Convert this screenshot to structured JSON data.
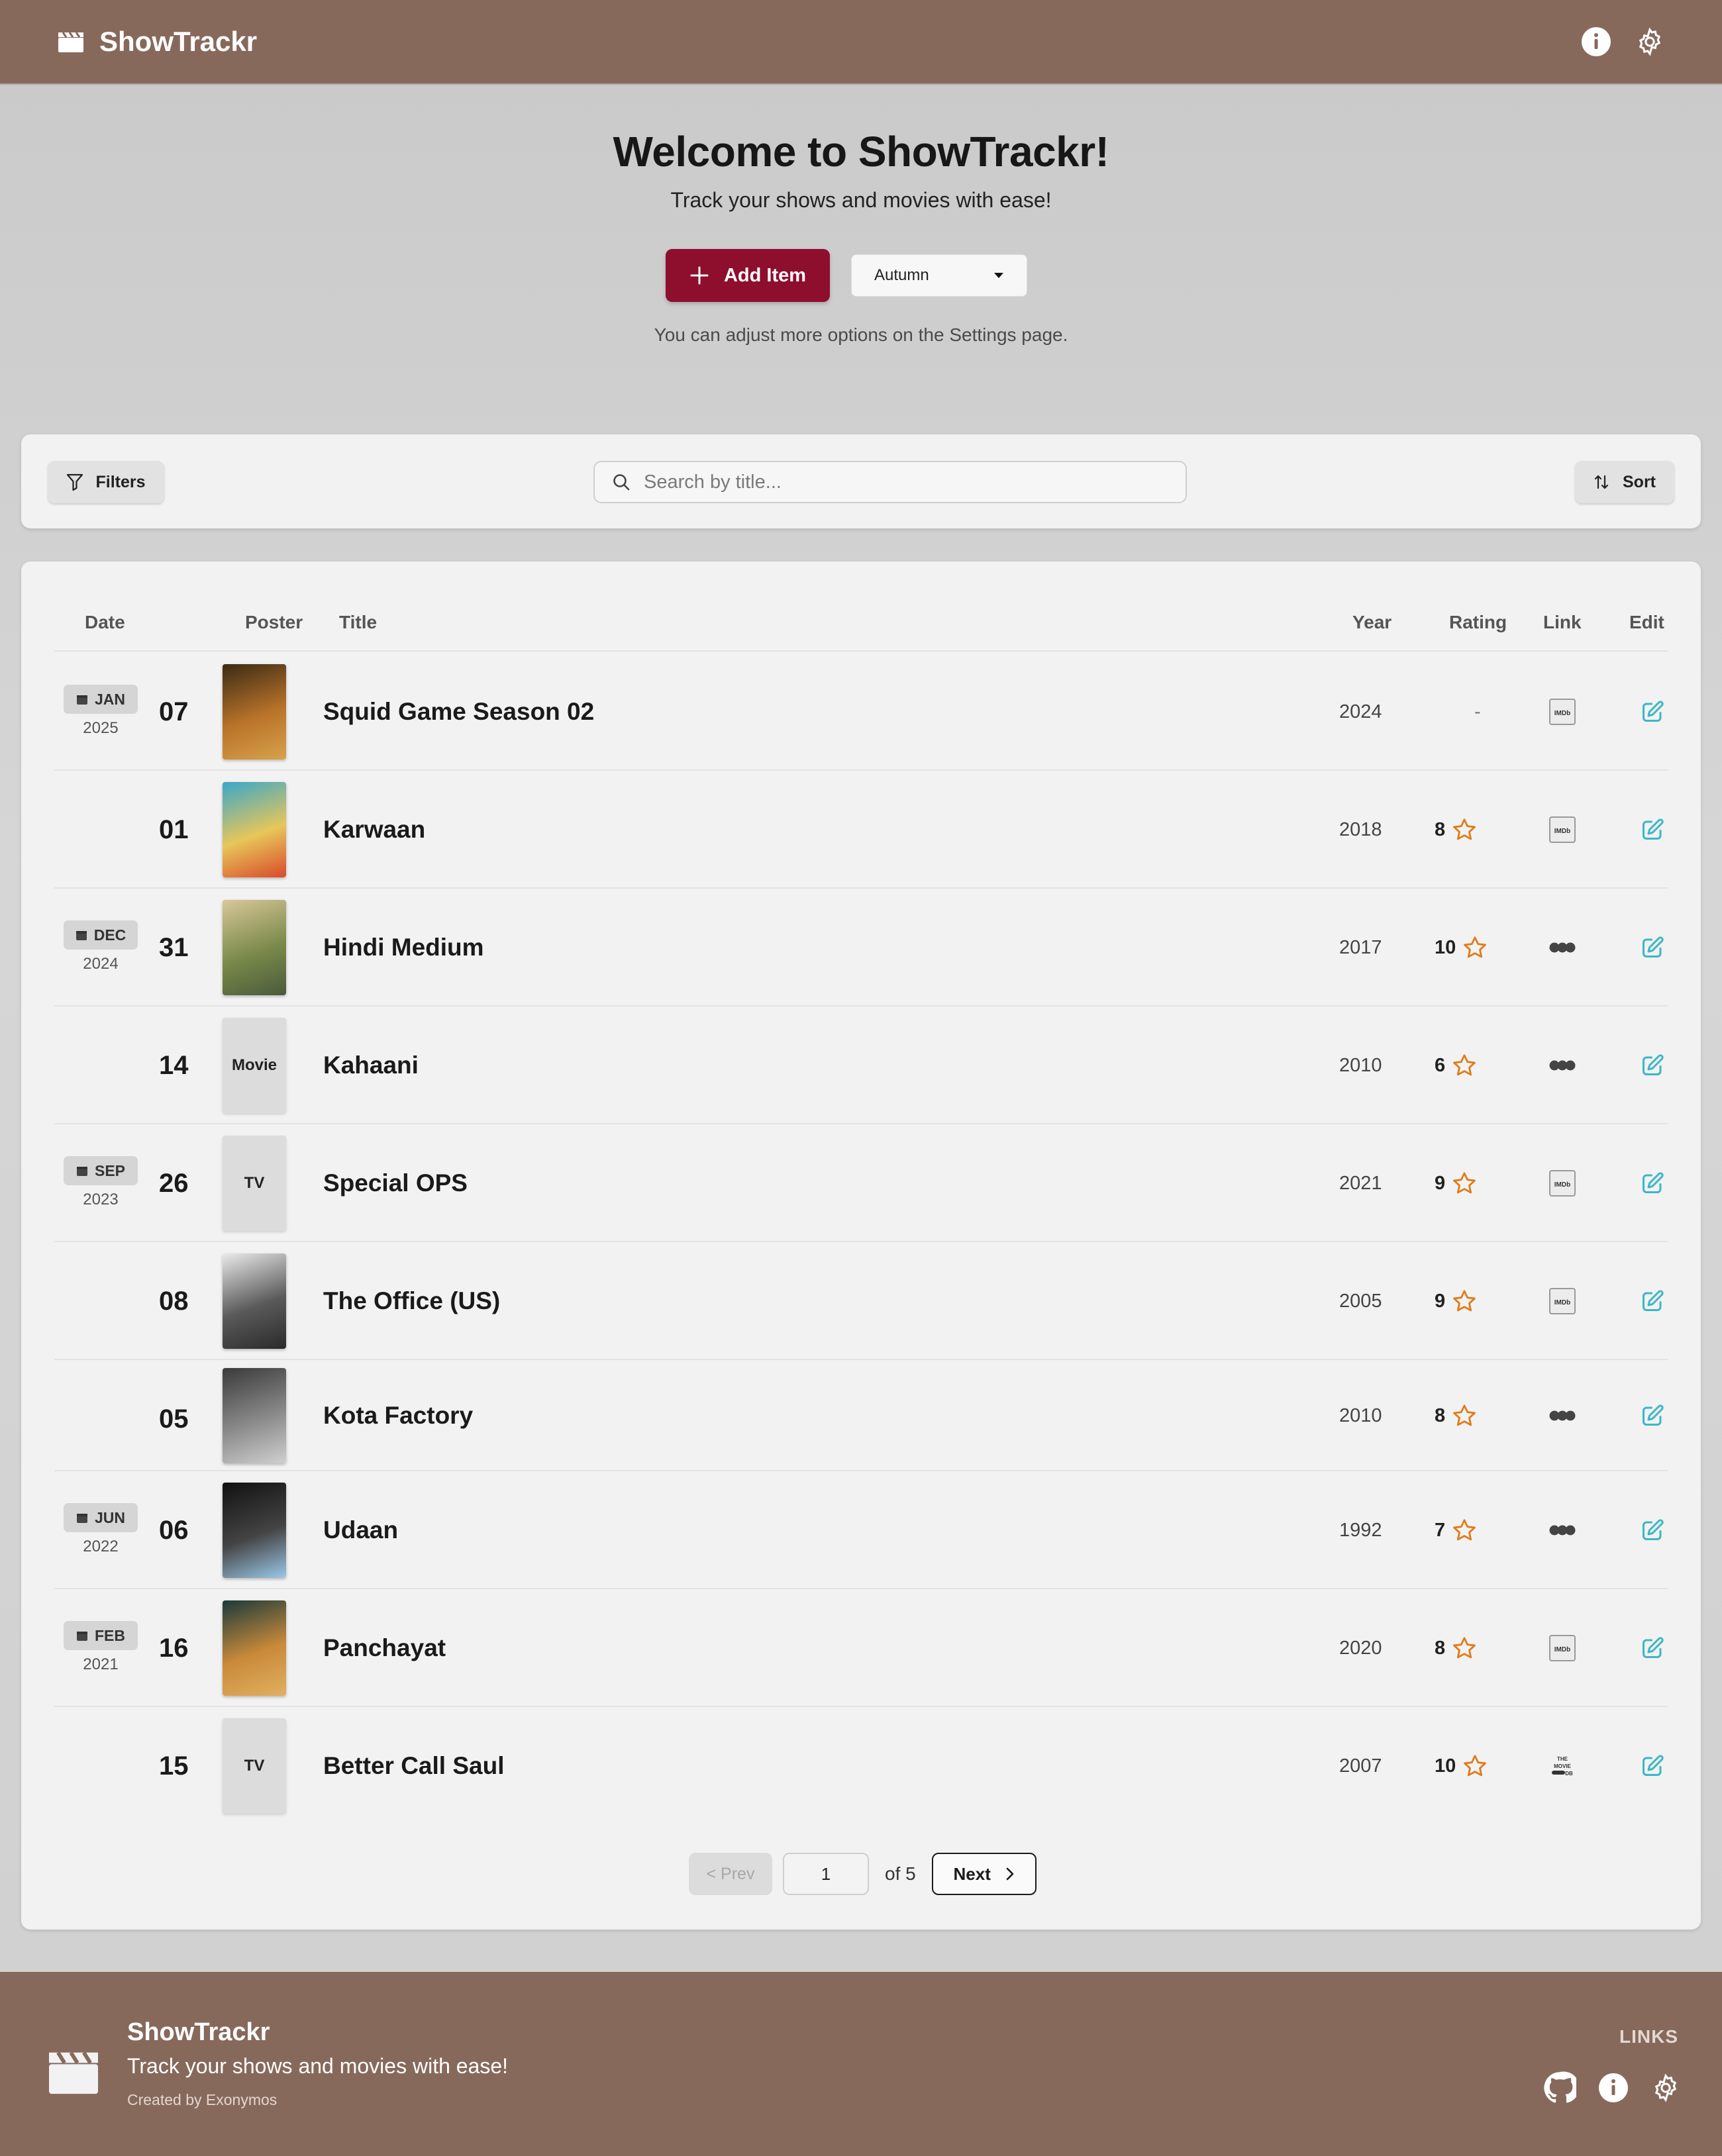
{
  "app": {
    "title": "ShowTrackr",
    "colors": {
      "brand_bar": "#87695b",
      "accent": "#8e0e2e",
      "star": "#e07b1a",
      "edit": "#3ab7c6"
    }
  },
  "header": {
    "logo_icon": "clapperboard-icon",
    "actions": [
      "info-icon",
      "gear-icon"
    ]
  },
  "hero": {
    "heading": "Welcome to ShowTrackr!",
    "tagline": "Track your shows and movies with ease!",
    "add_button": "Add Item",
    "theme_select": {
      "selected": "Autumn"
    },
    "hint": "You can adjust more options on the Settings page."
  },
  "toolbar": {
    "filters_label": "Filters",
    "search_placeholder": "Search by title...",
    "sort_label": "Sort"
  },
  "table": {
    "columns": [
      "Date",
      "Poster",
      "Title",
      "Year",
      "Rating",
      "Link",
      "Edit"
    ],
    "rows": [
      {
        "month": "JAN",
        "year_group": "2025",
        "day": "07",
        "poster": "image",
        "title": "Squid Game Season 02",
        "year": "2024",
        "rating": "-",
        "link": "imdb"
      },
      {
        "month": "",
        "year_group": "",
        "day": "01",
        "poster": "image",
        "title": "Karwaan",
        "year": "2018",
        "rating": "8",
        "link": "imdb"
      },
      {
        "month": "DEC",
        "year_group": "2024",
        "day": "31",
        "poster": "image",
        "title": "Hindi Medium",
        "year": "2017",
        "rating": "10",
        "link": "letterboxd"
      },
      {
        "month": "",
        "year_group": "",
        "day": "14",
        "poster": "Movie",
        "title": "Kahaani",
        "year": "2010",
        "rating": "6",
        "link": "letterboxd"
      },
      {
        "month": "SEP",
        "year_group": "2023",
        "day": "26",
        "poster": "TV",
        "title": "Special OPS",
        "year": "2021",
        "rating": "9",
        "link": "imdb"
      },
      {
        "month": "",
        "year_group": "",
        "day": "08",
        "poster": "image",
        "title": "The Office (US)",
        "year": "2005",
        "rating": "9",
        "link": "imdb"
      },
      {
        "month": "",
        "year_group": "",
        "day": "05",
        "poster": "image",
        "title": "Kota Factory",
        "year": "2010",
        "rating": "8",
        "link": "letterboxd"
      },
      {
        "month": "JUN",
        "year_group": "2022",
        "day": "06",
        "poster": "image",
        "title": "Udaan",
        "year": "1992",
        "rating": "7",
        "link": "letterboxd"
      },
      {
        "month": "FEB",
        "year_group": "2021",
        "day": "16",
        "poster": "image",
        "title": "Panchayat",
        "year": "2020",
        "rating": "8",
        "link": "imdb"
      },
      {
        "month": "",
        "year_group": "",
        "day": "15",
        "poster": "TV",
        "title": "Better Call Saul",
        "year": "2007",
        "rating": "10",
        "link": "tmdb"
      }
    ]
  },
  "pagination": {
    "prev_label": "< Prev",
    "current_page": "1",
    "of_label": "of 5",
    "next_label": "Next"
  },
  "footer": {
    "title": "ShowTrackr",
    "tagline": "Track your shows and movies with ease!",
    "credit": "Created by Exonymos",
    "links_label": "LINKS",
    "icons": [
      "github-icon",
      "info-icon",
      "gear-icon"
    ]
  }
}
